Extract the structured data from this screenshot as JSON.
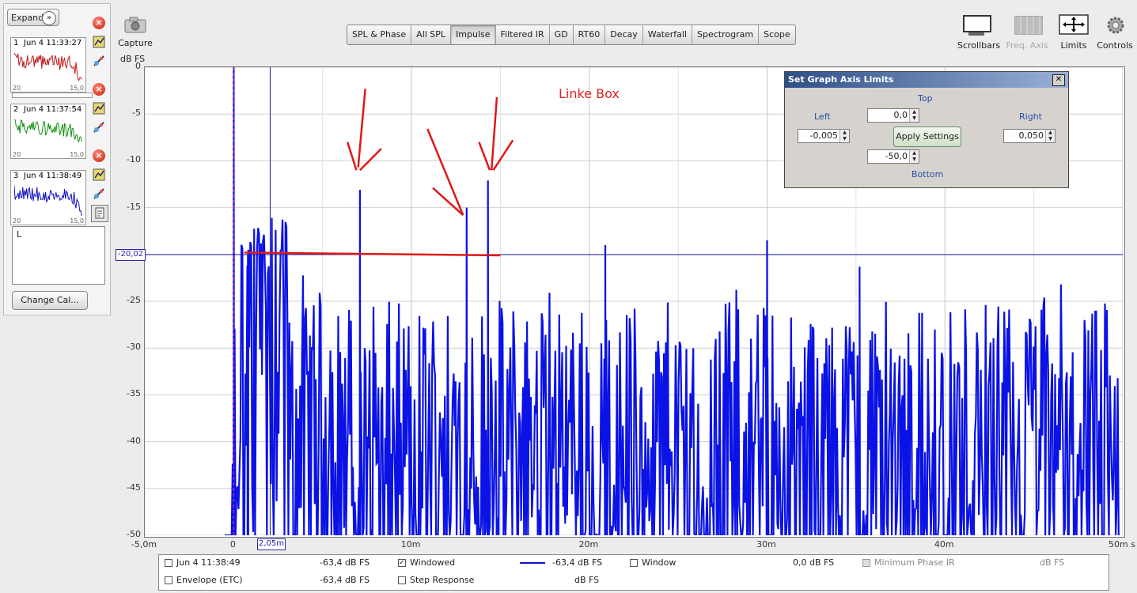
{
  "left_panel": {
    "expand_label": "Expand",
    "measurements": [
      {
        "index": "1",
        "date": "Jun 4 11:33:27",
        "color": "#c01818",
        "axis_left": "20",
        "axis_right": "15,0"
      },
      {
        "index": "2",
        "date": "Jun 4 11:37:54",
        "color": "#109010",
        "axis_left": "20",
        "axis_right": "15,0"
      },
      {
        "index": "3",
        "date": "Jun 4 11:38:49",
        "color": "#1010c0",
        "axis_left": "20",
        "axis_right": "15,0"
      }
    ],
    "note_text": "L",
    "change_cal_label": "Change Cal..."
  },
  "toolbar": {
    "capture_label": "Capture",
    "tabs": [
      "SPL & Phase",
      "All SPL",
      "Impulse",
      "Filtered IR",
      "GD",
      "RT60",
      "Decay",
      "Waterfall",
      "Spectrogram",
      "Scope"
    ],
    "active_tab": "Impulse",
    "right_tools": [
      {
        "label": "Scrollbars",
        "icon": "scrollbars-icon",
        "enabled": true
      },
      {
        "label": "Freq. Axis",
        "icon": "freq-axis-icon",
        "enabled": false
      },
      {
        "label": "Limits",
        "icon": "limits-icon",
        "enabled": true
      },
      {
        "label": "Controls",
        "icon": "gear-icon",
        "enabled": true
      }
    ]
  },
  "graph": {
    "y_unit": "dB FS",
    "cursor_y_value": "-20,02",
    "cursor_x_value": "2,05m",
    "annotation": "Linke Box"
  },
  "chart_data": {
    "type": "line",
    "title": "",
    "xlabel": "",
    "ylabel": "dB FS",
    "xlim": [
      -5.0,
      50.0
    ],
    "ylim": [
      -50,
      0
    ],
    "x_ticks": [
      "-5,0m",
      "0",
      "10m",
      "20m",
      "30m",
      "40m",
      "50m s"
    ],
    "y_ticks": [
      "0",
      "-5",
      "-10",
      "-15",
      "-20",
      "-25",
      "-30",
      "-35",
      "-40",
      "-45",
      "-50"
    ],
    "series_color": "#0a12e6",
    "peaks": [
      {
        "x": 0.0,
        "y": 0.0
      },
      {
        "x": 0.8,
        "y": -20.0
      },
      {
        "x": 7.1,
        "y": -13.1
      },
      {
        "x": 13.1,
        "y": -15.0
      },
      {
        "x": 14.3,
        "y": -12.1
      },
      {
        "x": 20.9,
        "y": -19.0
      },
      {
        "x": 30.0,
        "y": -18.5
      },
      {
        "x": 35.2,
        "y": -21.3
      }
    ],
    "noise_floor_db": [
      -45,
      -25
    ]
  },
  "axis_dialog": {
    "title": "Set Graph Axis Limits",
    "top_label": "Top",
    "top_value": "0,0",
    "left_label": "Left",
    "left_value": "-0,005",
    "right_label": "Right",
    "right_value": "0,050",
    "bottom_label": "Bottom",
    "bottom_value": "-50,0",
    "apply_label": "Apply Settings"
  },
  "legend": {
    "row1": {
      "meas_name": "Jun 4 11:38:49",
      "meas_value": "-63,4 dB FS",
      "windowed_label": "Windowed",
      "windowed_value": "-63,4 dB FS",
      "window_label": "Window",
      "window_value": "0,0 dB FS",
      "minphase_label": "Minimum Phase IR",
      "minphase_value": "dB FS"
    },
    "row2": {
      "envelope_label": "Envelope (ETC)",
      "envelope_value": "-63,4 dB FS",
      "step_label": "Step Response",
      "step_value": "dB FS"
    }
  }
}
